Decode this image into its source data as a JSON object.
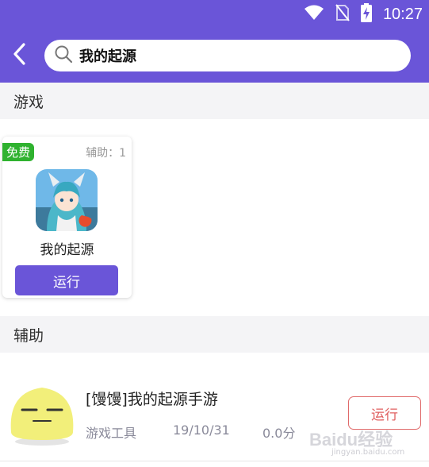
{
  "statusbar": {
    "time": "10:27"
  },
  "search": {
    "query": "我的起源"
  },
  "sections": {
    "games": "游戏",
    "aux": "辅助"
  },
  "game_card": {
    "badge": "免费",
    "aux_count": "辅助：1",
    "name": "我的起源",
    "run_label": "运行"
  },
  "aux_item": {
    "title": "[馒馒]我的起源手游",
    "category": "游戏工具",
    "date": "19/10/31",
    "size": "0.0分",
    "run_label": "运行"
  },
  "watermark": {
    "text": "Baidu经验",
    "sub": "jingyan.baidu.com"
  },
  "colors": {
    "accent": "#6a55d8",
    "free_badge": "#2fb22f",
    "run_outline": "#e06a6a"
  }
}
